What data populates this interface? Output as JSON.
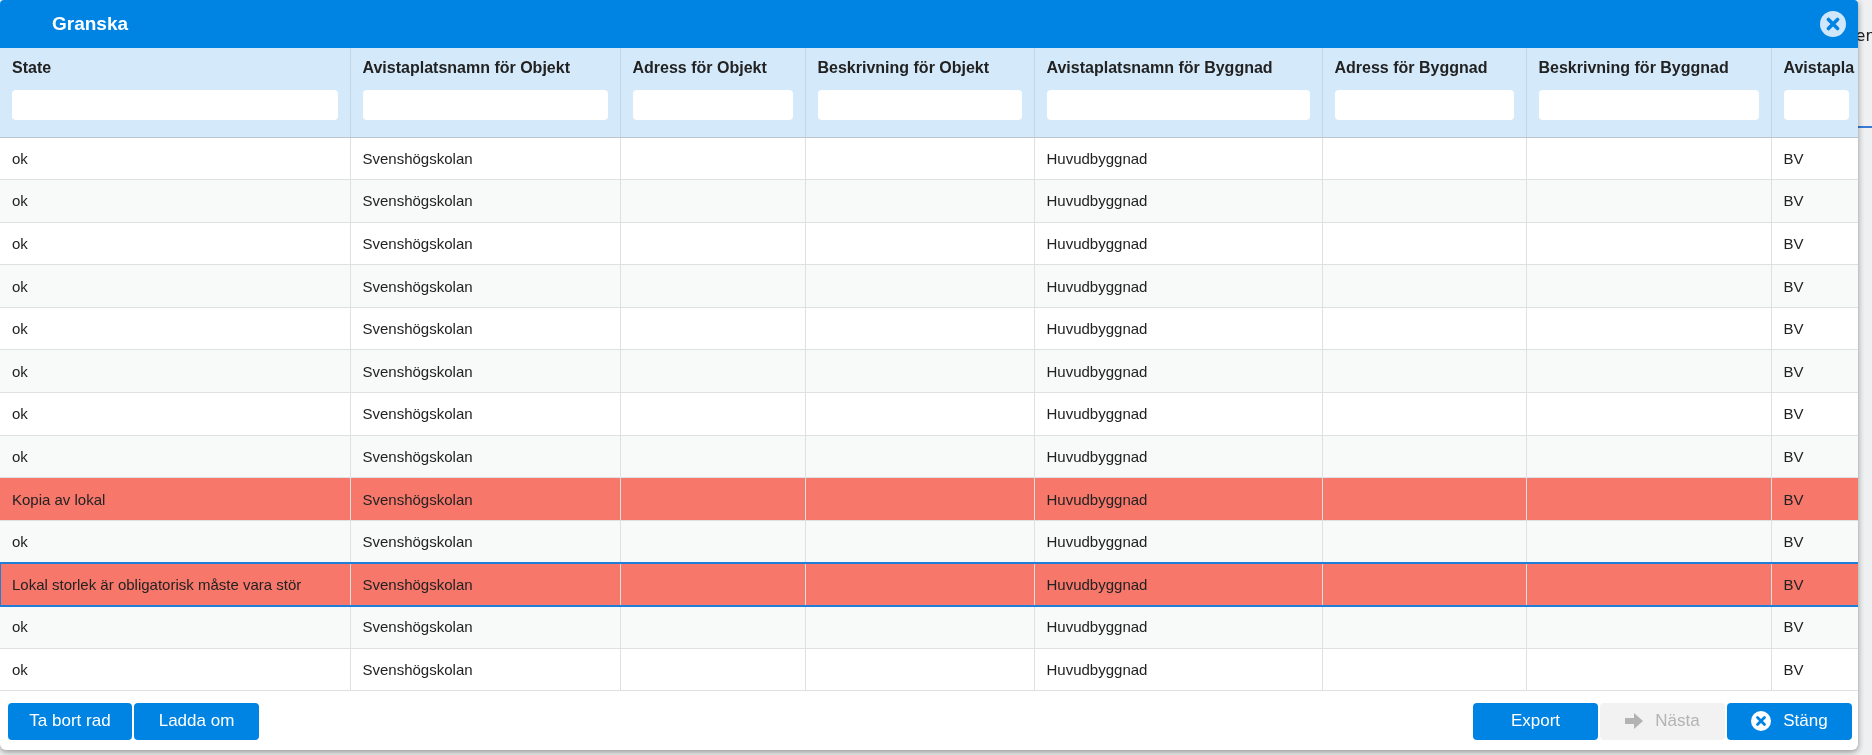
{
  "backdrop": {
    "text": "er"
  },
  "dialog": {
    "title": "Granska"
  },
  "table": {
    "columns": [
      "State",
      "Avistaplatsnamn för Objekt",
      "Adress för Objekt",
      "Beskrivning för Objekt",
      "Avistaplatsnamn för Byggnad",
      "Adress för Byggnad",
      "Beskrivning för Byggnad",
      "Avistapla"
    ],
    "rows": [
      {
        "cells": [
          "ok",
          "Svenshögskolan",
          null,
          null,
          "Huvudbyggnad",
          null,
          null,
          "BV"
        ],
        "error": false,
        "selected": false
      },
      {
        "cells": [
          "ok",
          "Svenshögskolan",
          null,
          null,
          "Huvudbyggnad",
          null,
          null,
          "BV"
        ],
        "error": false,
        "selected": false
      },
      {
        "cells": [
          "ok",
          "Svenshögskolan",
          null,
          null,
          "Huvudbyggnad",
          null,
          null,
          "BV"
        ],
        "error": false,
        "selected": false
      },
      {
        "cells": [
          "ok",
          "Svenshögskolan",
          null,
          null,
          "Huvudbyggnad",
          null,
          null,
          "BV"
        ],
        "error": false,
        "selected": false
      },
      {
        "cells": [
          "ok",
          "Svenshögskolan",
          null,
          null,
          "Huvudbyggnad",
          null,
          null,
          "BV"
        ],
        "error": false,
        "selected": false
      },
      {
        "cells": [
          "ok",
          "Svenshögskolan",
          null,
          null,
          "Huvudbyggnad",
          null,
          null,
          "BV"
        ],
        "error": false,
        "selected": false
      },
      {
        "cells": [
          "ok",
          "Svenshögskolan",
          null,
          null,
          "Huvudbyggnad",
          null,
          null,
          "BV"
        ],
        "error": false,
        "selected": false
      },
      {
        "cells": [
          "ok",
          "Svenshögskolan",
          null,
          null,
          "Huvudbyggnad",
          null,
          null,
          "BV"
        ],
        "error": false,
        "selected": false
      },
      {
        "cells": [
          "Kopia av lokal",
          "Svenshögskolan",
          null,
          null,
          "Huvudbyggnad",
          null,
          null,
          "BV"
        ],
        "error": true,
        "selected": false
      },
      {
        "cells": [
          "ok",
          "Svenshögskolan",
          null,
          null,
          "Huvudbyggnad",
          null,
          null,
          "BV"
        ],
        "error": false,
        "selected": false
      },
      {
        "cells": [
          "Lokal storlek är obligatorisk måste vara stör",
          "Svenshögskolan",
          null,
          null,
          "Huvudbyggnad",
          null,
          null,
          "BV"
        ],
        "error": true,
        "selected": true
      },
      {
        "cells": [
          "ok",
          "Svenshögskolan",
          null,
          null,
          "Huvudbyggnad",
          null,
          null,
          "BV"
        ],
        "error": false,
        "selected": false
      },
      {
        "cells": [
          "ok",
          "Svenshögskolan",
          null,
          null,
          "Huvudbyggnad",
          null,
          null,
          "BV"
        ],
        "error": false,
        "selected": false
      }
    ]
  },
  "footer": {
    "left_buttons": [
      {
        "label": "Ta bort rad",
        "disabled": false
      },
      {
        "label": "Ladda om",
        "disabled": false
      }
    ],
    "right_buttons": [
      {
        "label": "Export",
        "kind": "plain",
        "disabled": false
      },
      {
        "label": "Nästa",
        "kind": "next",
        "disabled": true
      },
      {
        "label": "Stäng",
        "kind": "close",
        "disabled": false
      }
    ]
  }
}
